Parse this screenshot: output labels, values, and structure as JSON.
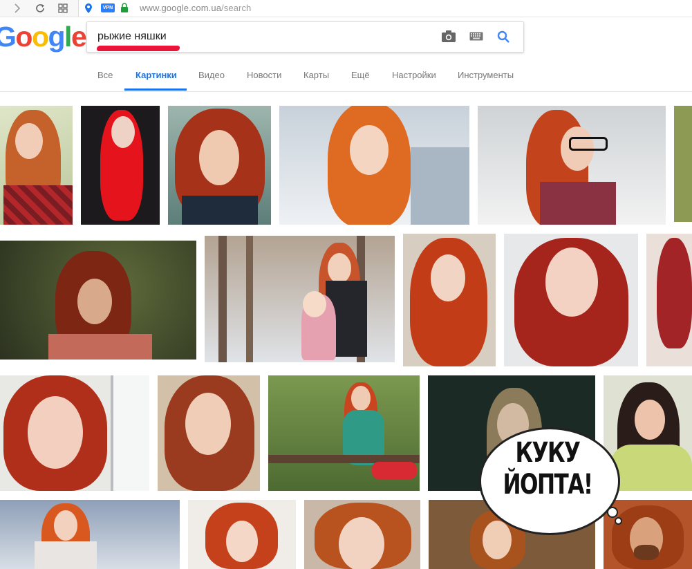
{
  "browser": {
    "url_host": "www.google.com.ua",
    "url_path": "/search",
    "vpn_badge": "VPN"
  },
  "logo": [
    "G",
    "o",
    "o",
    "g",
    "l",
    "e"
  ],
  "logo_colors": [
    "#4285F4",
    "#EA4335",
    "#FBBC05",
    "#4285F4",
    "#34A853",
    "#EA4335"
  ],
  "search": {
    "query": "рыжие няшки"
  },
  "tabs": [
    {
      "label": "Все"
    },
    {
      "label": "Картинки",
      "active": true
    },
    {
      "label": "Видео"
    },
    {
      "label": "Новости"
    },
    {
      "label": "Карты"
    },
    {
      "label": "Ещё"
    },
    {
      "label": "Настройки"
    },
    {
      "label": "Инструменты"
    }
  ],
  "overlay": {
    "line1": "КУКУ",
    "line2": "ЙОПТА!"
  },
  "colors": {
    "accent": "#1a73e8",
    "hair": "#c8401a",
    "highlight": "#e8002a"
  }
}
